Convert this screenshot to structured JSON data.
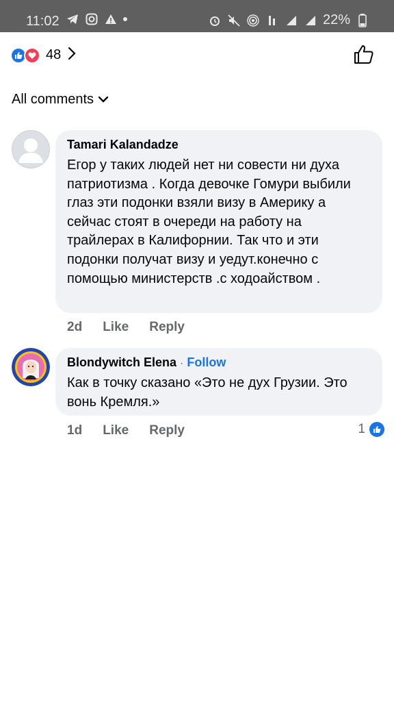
{
  "status_bar": {
    "time": "11:02",
    "battery": "22%"
  },
  "reactions": {
    "count": "48"
  },
  "sort": {
    "label": "All comments"
  },
  "comments": [
    {
      "author": "Tamari Kalandadze",
      "text": "Егор у таких людей нет ни совести ни духа патриотизма . Когда девочке Гомури выбили глаз эти подонки взяли визу в Америку а сейчас стоят в очереди на работу на трайлерах в Калифорнии. Так что и эти подонки получат  визу и уедут.конечно с помощью министерств .с ходоайством .",
      "age": "2d",
      "like_label": "Like",
      "reply_label": "Reply"
    },
    {
      "author": "Blondywitch Elena",
      "follow_label": "Follow",
      "text": "Как в точку сказано «Это не дух Грузии. Это вонь Кремля.»",
      "age": "1d",
      "like_label": "Like",
      "reply_label": "Reply",
      "like_count": "1"
    }
  ],
  "colors": {
    "accent": "#1b74e4",
    "bubble": "#f0f2f5",
    "muted": "#65676b"
  }
}
